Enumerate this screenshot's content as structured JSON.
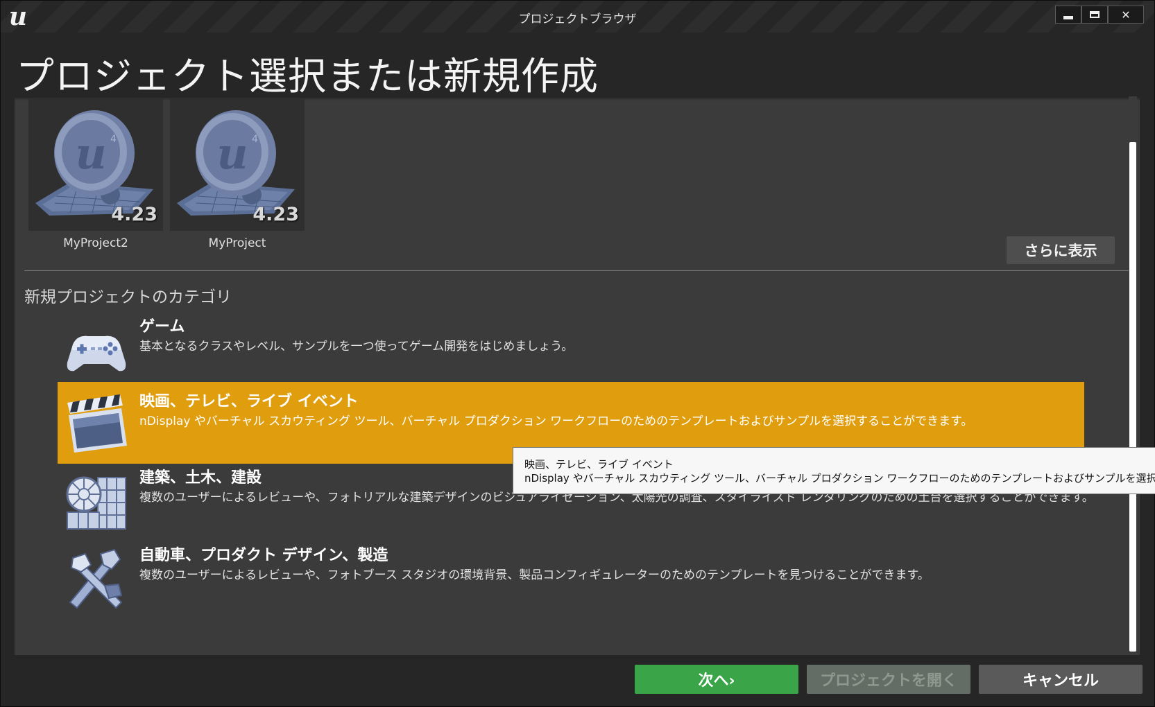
{
  "window": {
    "title": "プロジェクトブラウザ",
    "logo": "u",
    "close_glyph": "✕"
  },
  "page": {
    "title": "プロジェクト選択または新規作成"
  },
  "projects": [
    {
      "name": "MyProject2",
      "version": "4.23"
    },
    {
      "name": "MyProject",
      "version": "4.23"
    }
  ],
  "more_button": "さらに表示",
  "category_heading": "新規プロジェクトのカテゴリ",
  "categories": [
    {
      "title": "ゲーム",
      "description": "基本となるクラスやレベル、サンプルを一つ使ってゲーム開発をはじめましょう。",
      "icon": "gamepad-icon"
    },
    {
      "title": "映画、テレビ、ライブ イベント",
      "description": "nDisplay やバーチャル スカウティング ツール、バーチャル プロダクション ワークフローのためのテンプレートおよびサンプルを選択することができます。",
      "icon": "clapperboard-icon",
      "selected": true
    },
    {
      "title": "建築、土木、建設",
      "description": "複数のユーザーによるレビューや、フォトリアルな建築デザインのビジュアライゼーション、太陽光の調査、スタイライズド レンダリングのための土台を選択することができます。",
      "icon": "architecture-icon"
    },
    {
      "title": "自動車、プロダクト デザイン、製造",
      "description": "複数のユーザーによるレビューや、フォトブース スタジオの環境背景、製品コンフィギュレーターのためのテンプレートを見つけることができます。",
      "icon": "tools-icon"
    }
  ],
  "tooltip": {
    "title": "映画、テレビ、ライブ イベント",
    "description": "nDisplay やバーチャル スカウティング ツール、バーチャル プロダクション ワークフローのためのテンプレートおよびサンプルを選択する"
  },
  "buttons": {
    "next": "次へ›",
    "open": "プロジェクトを開く",
    "cancel": "キャンセル"
  },
  "colors": {
    "selected_highlight": "#e09e0e",
    "next_button": "#3aa449",
    "panel": "#3b3b3b"
  }
}
